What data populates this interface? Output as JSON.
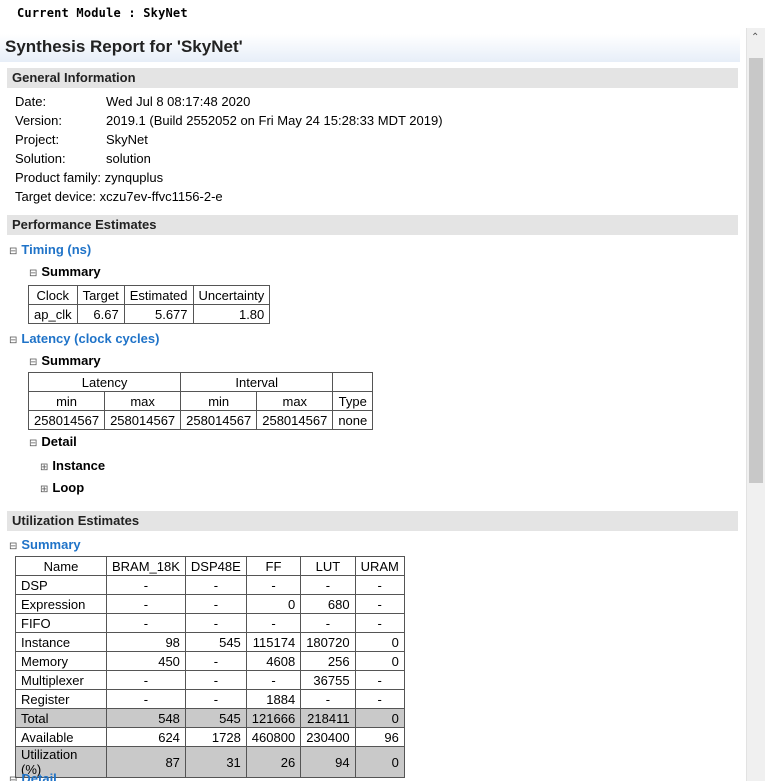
{
  "module_bar": "Current Module : SkyNet",
  "report_title": "Synthesis Report for 'SkyNet'",
  "general": {
    "heading": "General Information",
    "rows": [
      {
        "label": "Date:",
        "value": "Wed Jul 8 08:17:48 2020"
      },
      {
        "label": "Version:",
        "value": "2019.1 (Build 2552052 on Fri May 24 15:28:33 MDT 2019)"
      },
      {
        "label": "Project:",
        "value": "SkyNet"
      },
      {
        "label": "Solution:",
        "value": "solution"
      },
      {
        "label": "Product family:",
        "value": "zynquplus"
      },
      {
        "label": "Target device:",
        "value": "xczu7ev-ffvc1156-2-e"
      }
    ]
  },
  "performance": {
    "heading": "Performance Estimates",
    "timing": {
      "toggle": "Timing (ns)",
      "summary": "Summary",
      "headers": [
        "Clock",
        "Target",
        "Estimated",
        "Uncertainty"
      ],
      "row": [
        "ap_clk",
        "6.67",
        "5.677",
        "1.80"
      ]
    },
    "latency": {
      "toggle": "Latency (clock cycles)",
      "summary": "Summary",
      "group_headers": [
        "Latency",
        "Interval"
      ],
      "sub_headers": [
        "min",
        "max",
        "min",
        "max",
        "Type"
      ],
      "row": [
        "258014567",
        "258014567",
        "258014567",
        "258014567",
        "none"
      ],
      "detail": "Detail",
      "instance": "Instance",
      "loop": "Loop"
    }
  },
  "utilization": {
    "heading": "Utilization Estimates",
    "summary": "Summary",
    "headers": [
      "Name",
      "BRAM_18K",
      "DSP48E",
      "FF",
      "LUT",
      "URAM"
    ],
    "rows": [
      [
        "DSP",
        "-",
        "-",
        "-",
        "-",
        "-"
      ],
      [
        "Expression",
        "-",
        "-",
        "0",
        "680",
        "-"
      ],
      [
        "FIFO",
        "-",
        "-",
        "-",
        "-",
        "-"
      ],
      [
        "Instance",
        "98",
        "545",
        "115174",
        "180720",
        "0"
      ],
      [
        "Memory",
        "450",
        "-",
        "4608",
        "256",
        "0"
      ],
      [
        "Multiplexer",
        "-",
        "-",
        "-",
        "36755",
        "-"
      ],
      [
        "Register",
        "-",
        "-",
        "1884",
        "-",
        "-"
      ],
      [
        "Total",
        "548",
        "545",
        "121666",
        "218411",
        "0"
      ],
      [
        "Available",
        "624",
        "1728",
        "460800",
        "230400",
        "96"
      ],
      [
        "Utilization (%)",
        "87",
        "31",
        "26",
        "94",
        "0"
      ]
    ],
    "detail": "Detail"
  },
  "icons": {
    "collapse": "⊟",
    "expand": "⊞",
    "scroll_up": "⌃"
  }
}
